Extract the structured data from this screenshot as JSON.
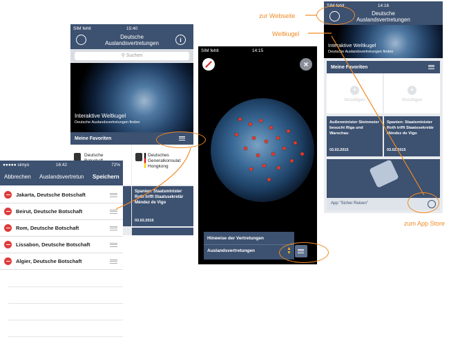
{
  "phone1": {
    "status": {
      "carrier": "SIM fehlt",
      "time": "15:40"
    },
    "title_line1": "Deutsche",
    "title_line2": "Auslandsvertretungen",
    "search_placeholder": "Suchen",
    "hero_title": "Interaktive Weltkugel",
    "hero_subtitle": "Deutsche Auslandsvertretungen finden",
    "favorites_label": "Meine Favoriten",
    "fav1_line1": "Deutsche",
    "fav1_line2": "Botschaft",
    "fav2_line1": "Deutsches",
    "fav2_line2": "Generalkonsulat",
    "fav2_line3": "Hongkong",
    "news_line1": "Spanien: Staatsminister",
    "news_line2": "Roth trifft Staatssekretär",
    "news_line3": "Méndez de Vigo",
    "news_date": "03.02.2015"
  },
  "phone2": {
    "status": {
      "carrier": "SIM fehlt",
      "time": "14:15"
    },
    "panel_title": "Hinweise der Vertretungen",
    "panel_label": "Auslandsvertretungen"
  },
  "phone3": {
    "status": {
      "carrier": "SIM fehlt",
      "time": "14:16"
    },
    "title_line1": "Deutsche",
    "title_line2": "Auslandsvertretungen",
    "hero_title": "Interaktive Weltkugel",
    "hero_subtitle": "Deutsche Auslandsvertretungen finden",
    "favorites_label": "Meine Favoriten",
    "add_label": "hinzufügen",
    "news1_line1": "Außenminister Steinmeier",
    "news1_line2": "besucht Riga und",
    "news1_line3": "Warschau",
    "news1_date": "03.02.2015",
    "news2_line1": "Spanien: Staatsminister",
    "news2_line2": "Roth trifft Staatssekretär",
    "news2_line3": "Méndez de Vigo",
    "news2_date": "03.02.2015",
    "app_label": "App \"Sicher Reisen\""
  },
  "phone4": {
    "status": {
      "carrier": "●●●●● simyo",
      "time": "16:42",
      "battery": "72%"
    },
    "cancel": "Abbrechen",
    "title": "Auslandsvertretun",
    "save": "Speichern",
    "rows": [
      "Jakarta, Deutsche Botschaft",
      "Beirut, Deutsche Botschaft",
      "Rom, Deutsche Botschaft",
      "Lissabon, Deutsche Botschaft",
      "Algier, Deutsche Botschaft"
    ]
  },
  "annotations": {
    "website": "zur Webseite",
    "globe": "Weltkugel",
    "appstore": "zum App Store"
  },
  "colors": {
    "header": "#3d5170",
    "accent": "#f08a24",
    "delete": "#e03a3a"
  }
}
